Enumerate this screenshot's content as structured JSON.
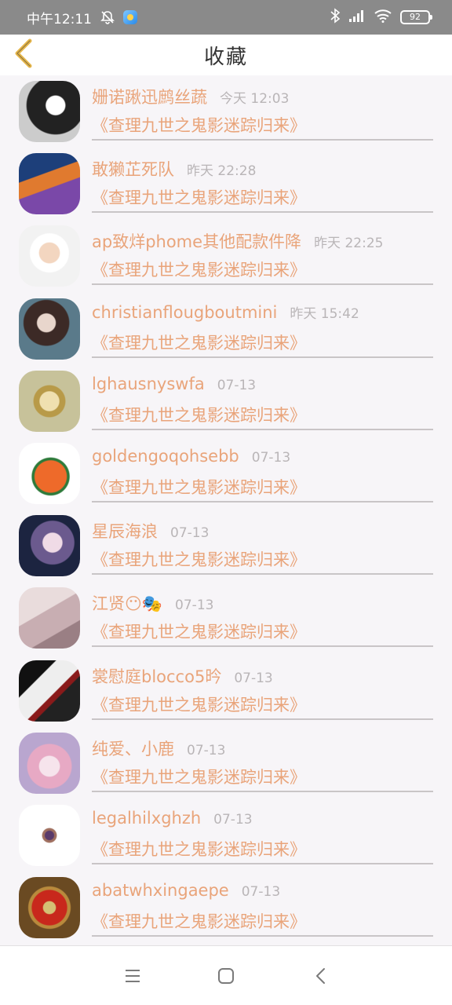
{
  "status_bar": {
    "time": "中午12:11",
    "battery": "92",
    "icons": [
      "bell-off-icon",
      "app-notification-icon",
      "bluetooth-icon",
      "signal-icon",
      "wifi-icon",
      "battery-icon"
    ]
  },
  "header": {
    "title": "收藏",
    "back_icon": "chevron-left-icon",
    "accent_color": "#e6b64a"
  },
  "colors": {
    "username": "#e9a47a",
    "movie": "#e9a47a",
    "time": "#b9b5b7",
    "divider": "#c9c5c7"
  },
  "items": [
    {
      "username": "姗诺踿迅鹧丝蔬",
      "time": "今天 12:03",
      "movie": "《查理九世之鬼影迷踪归来》"
    },
    {
      "username": "敢獭芷死队",
      "time": "昨天 22:28",
      "movie": "《查理九世之鬼影迷踪归来》"
    },
    {
      "username": "ap致烊phome其他配款件降",
      "time": "昨天 22:25",
      "movie": "《查理九世之鬼影迷踪归来》"
    },
    {
      "username": "christianflougboutmini",
      "time": "昨天 15:42",
      "movie": "《查理九世之鬼影迷踪归来》"
    },
    {
      "username": "lghausnyswfa",
      "time": "07-13",
      "movie": "《查理九世之鬼影迷踪归来》"
    },
    {
      "username": "goldengoqohsebb",
      "time": "07-13",
      "movie": "《查理九世之鬼影迷踪归来》"
    },
    {
      "username": "星辰海浪",
      "time": "07-13",
      "movie": "《查理九世之鬼影迷踪归来》"
    },
    {
      "username": "江贤😶🎭",
      "time": "07-13",
      "movie": "《查理九世之鬼影迷踪归来》"
    },
    {
      "username": "裳慰庭blocco5昑",
      "time": "07-13",
      "movie": "《查理九世之鬼影迷踪归来》"
    },
    {
      "username": "纯爱、小鹿",
      "time": "07-13",
      "movie": "《查理九世之鬼影迷踪归来》"
    },
    {
      "username": "legalhilxghzh",
      "time": "07-13",
      "movie": "《查理九世之鬼影迷踪归来》"
    },
    {
      "username": "abatwhxingaepe",
      "time": "07-13",
      "movie": "《查理九世之鬼影迷踪归来》"
    }
  ],
  "nav_bar": {
    "icons": [
      "menu-icon",
      "home-square-icon",
      "back-chevron-icon"
    ]
  }
}
